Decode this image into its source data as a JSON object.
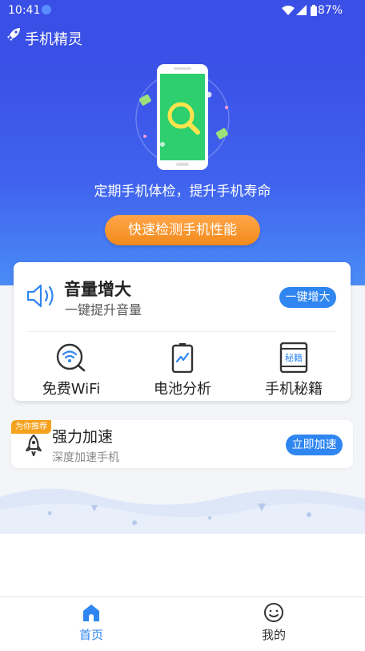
{
  "status_bar": {
    "time": "10:41",
    "battery": "87%",
    "icons": [
      "download-icon",
      "wifi-icon",
      "signal-icon",
      "battery-icon"
    ]
  },
  "app_bar": {
    "title": "手机精灵",
    "icon": "rocket-icon"
  },
  "hero": {
    "tagline": "定期手机体检，提升手机寿命",
    "detect_button": "快速检测手机性能"
  },
  "main_card": {
    "title": "音量增大",
    "subtitle": "一键提升音量",
    "action": "一键增大",
    "features": [
      {
        "label": "免费WiFi",
        "icon": "wifi-search-icon"
      },
      {
        "label": "电池分析",
        "icon": "battery-analysis-icon"
      },
      {
        "label": "手机秘籍",
        "icon": "secret-book-icon",
        "icon_text": "秘籍"
      }
    ]
  },
  "promo": {
    "badge": "为你推荐",
    "title": "强力加速",
    "subtitle": "深度加速手机",
    "action": "立即加速"
  },
  "bottom_nav": [
    {
      "label": "首页",
      "icon": "home-icon",
      "active": true
    },
    {
      "label": "我的",
      "icon": "profile-icon",
      "active": false
    }
  ],
  "colors": {
    "header": "#3a4fe6",
    "accent": "#2f86f0",
    "orange": "#f5a11c",
    "active_tab": "#2f86f0"
  }
}
